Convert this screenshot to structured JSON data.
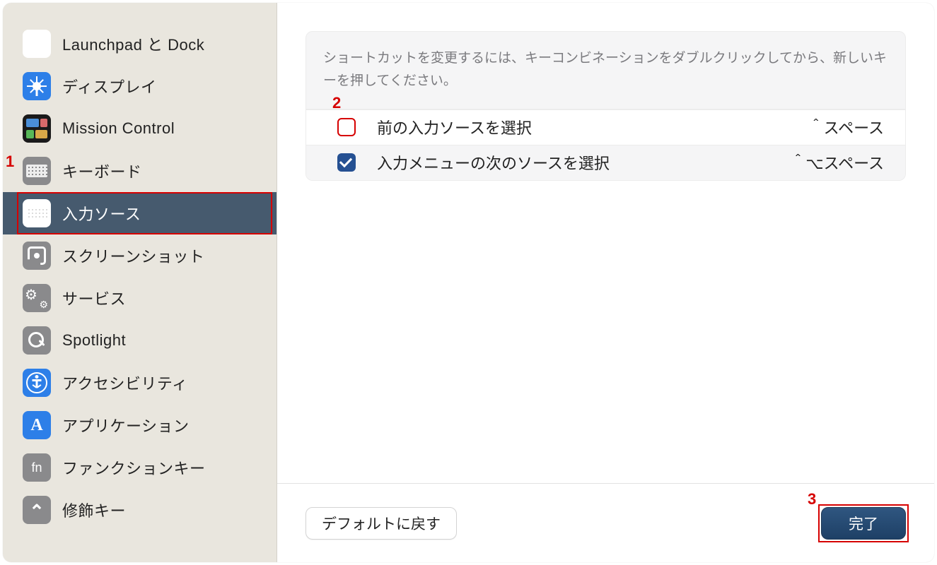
{
  "annotations": {
    "a1": "1",
    "a2": "2",
    "a3": "3"
  },
  "sidebar": {
    "items": [
      {
        "label": "Launchpad と Dock"
      },
      {
        "label": "ディスプレイ"
      },
      {
        "label": "Mission Control"
      },
      {
        "label": "キーボード"
      },
      {
        "label": "入力ソース"
      },
      {
        "label": "スクリーンショット"
      },
      {
        "label": "サービス"
      },
      {
        "label": "Spotlight"
      },
      {
        "label": "アクセシビリティ"
      },
      {
        "label": "アプリケーション"
      },
      {
        "label": "ファンクションキー"
      },
      {
        "label": "修飾キー"
      }
    ]
  },
  "content": {
    "info": "ショートカットを変更するには、キーコンビネーションをダブルクリックしてから、新しいキーを押してください。",
    "shortcuts": [
      {
        "label": "前の入力ソースを選択",
        "keys": "＾スペース"
      },
      {
        "label": "入力メニューの次のソースを選択",
        "keys": "＾⌥スペース"
      }
    ]
  },
  "footer": {
    "reset": "デフォルトに戻す",
    "done": "完了"
  },
  "fn_text": "fn"
}
